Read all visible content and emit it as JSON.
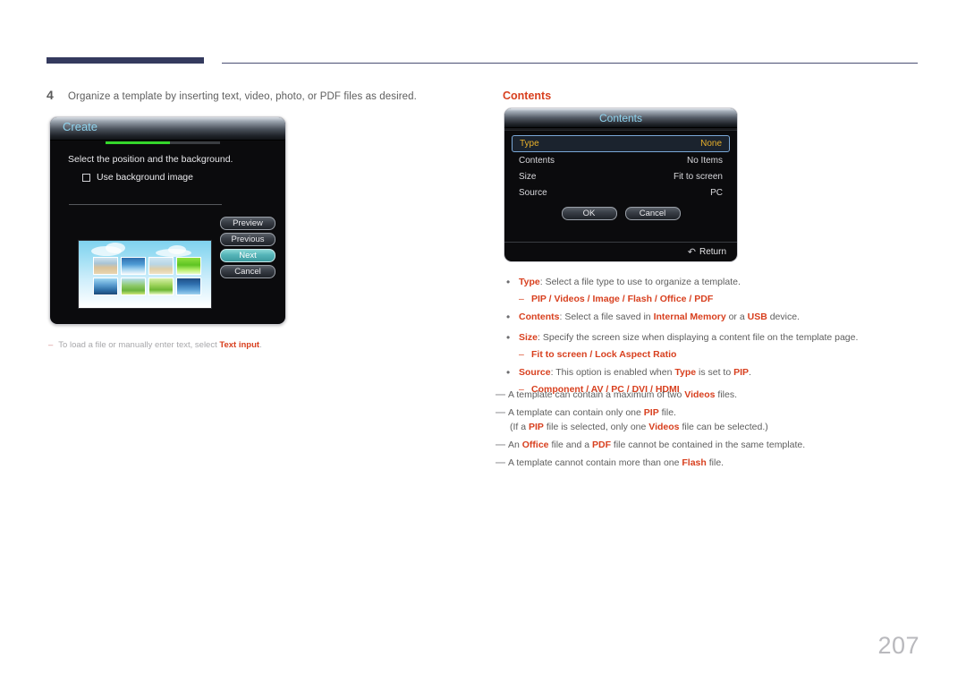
{
  "header": {
    "rule_color": "#343a5e",
    "thin_rule_color": "#4a4f73"
  },
  "step": {
    "number": "4",
    "text": "Organize a template by inserting text, video, photo, or PDF files as desired."
  },
  "create_dialog": {
    "title": "Create",
    "instruction": "Select the position and the background.",
    "checkbox_label": "Use background image",
    "checkbox_checked": false,
    "progress_accent": "#35d72b",
    "buttons": [
      {
        "label": "Preview",
        "active": false
      },
      {
        "label": "Previous",
        "active": false
      },
      {
        "label": "Next",
        "active": true
      },
      {
        "label": "Cancel",
        "active": false
      }
    ]
  },
  "left_note": {
    "dash": "–",
    "text_before": "To load a file or manually enter text, select ",
    "bold": "Text input",
    "text_after": "."
  },
  "contents_heading": "Contents",
  "contents_dialog": {
    "title": "Contents",
    "rows": [
      {
        "label": "Type",
        "value": "None",
        "selected": true
      },
      {
        "label": "Contents",
        "value": "No Items",
        "selected": false
      },
      {
        "label": "Size",
        "value": "Fit to screen",
        "selected": false
      },
      {
        "label": "Source",
        "value": "PC",
        "selected": false
      }
    ],
    "buttons": [
      {
        "label": "OK"
      },
      {
        "label": "Cancel"
      }
    ],
    "return_icon": "↶",
    "return_label": "Return",
    "highlight_text_color": "#e8b02a",
    "highlight_border_color": "#7aa8d8"
  },
  "bullets": [
    {
      "marker": "•",
      "term": "Type",
      "text": ": Select a file type to use to organize a template.",
      "sub": {
        "dash": "–",
        "text": "PIP / Videos / Image / Flash / Office / PDF"
      }
    },
    {
      "marker": "•",
      "term": "Contents",
      "text_parts": [
        {
          "t": ": Select a file saved in ",
          "b": false
        },
        {
          "t": "Internal Memory",
          "b": true
        },
        {
          "t": " or a ",
          "b": false
        },
        {
          "t": "USB",
          "b": true
        },
        {
          "t": " device.",
          "b": false
        }
      ]
    },
    {
      "marker": "•",
      "term": "Size",
      "text": ": Specify the screen size when displaying a content file on the template page.",
      "sub": {
        "dash": "–",
        "text": "Fit to screen / Lock Aspect Ratio"
      }
    },
    {
      "marker": "•",
      "term": "Source",
      "text_parts": [
        {
          "t": ": This option is enabled when ",
          "b": false
        },
        {
          "t": "Type",
          "b": true
        },
        {
          "t": " is set to ",
          "b": false
        },
        {
          "t": "PIP",
          "b": true
        },
        {
          "t": ".",
          "b": false
        }
      ],
      "sub": {
        "dash": "–",
        "text": "Component / AV / PC / DVI / HDMI"
      }
    }
  ],
  "notes": [
    {
      "dash": "—",
      "parts": [
        {
          "t": "A template can contain a maximum of two ",
          "b": false
        },
        {
          "t": "Videos",
          "b": true
        },
        {
          "t": " files.",
          "b": false
        }
      ]
    },
    {
      "dash": "—",
      "parts": [
        {
          "t": "A template can contain only one ",
          "b": false
        },
        {
          "t": "PIP",
          "b": true
        },
        {
          "t": " file.",
          "b": false
        }
      ],
      "subparts": [
        {
          "t": "(If a ",
          "b": false
        },
        {
          "t": "PIP",
          "b": true
        },
        {
          "t": " file is selected, only one ",
          "b": false
        },
        {
          "t": "Videos",
          "b": true
        },
        {
          "t": " file can be selected.)",
          "b": false
        }
      ]
    },
    {
      "dash": "—",
      "parts": [
        {
          "t": "An ",
          "b": false
        },
        {
          "t": "Office",
          "b": true
        },
        {
          "t": " file and a ",
          "b": false
        },
        {
          "t": "PDF",
          "b": true
        },
        {
          "t": " file cannot be contained in the same template.",
          "b": false
        }
      ]
    },
    {
      "dash": "—",
      "parts": [
        {
          "t": "A template cannot contain more than one ",
          "b": false
        },
        {
          "t": "Flash",
          "b": true
        },
        {
          "t": " file.",
          "b": false
        }
      ]
    }
  ],
  "page_number": "207",
  "thumbnails": [
    "t1",
    "t2",
    "t3",
    "t4",
    "t5",
    "t6",
    "t7",
    "t8"
  ]
}
